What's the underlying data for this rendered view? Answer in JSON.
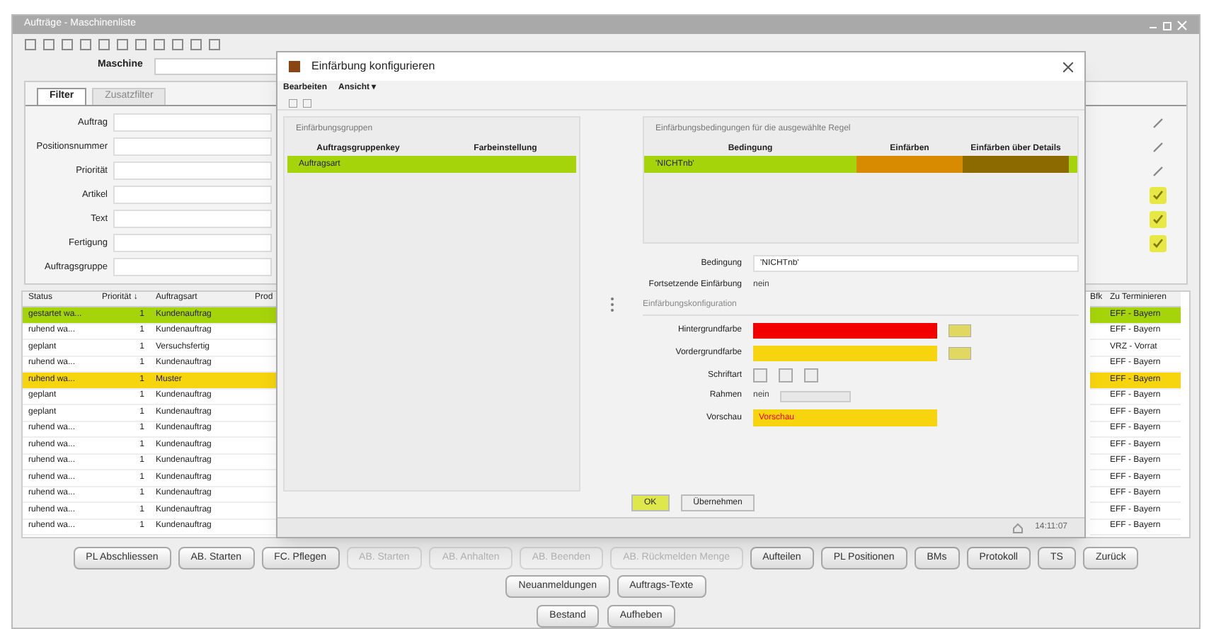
{
  "window": {
    "title": "Aufträge - Maschinenliste"
  },
  "machine_field": {
    "label": "Maschine"
  },
  "tabs": [
    {
      "label": "Filter",
      "selected": true
    },
    {
      "label": "Zusatzfilter",
      "selected": false
    }
  ],
  "filters": [
    {
      "label": "Auftrag",
      "kind": "edit"
    },
    {
      "label": "Positionsnummer",
      "kind": "edit"
    },
    {
      "label": "Priorität",
      "kind": "edit"
    },
    {
      "label": "Artikel",
      "kind": "check"
    },
    {
      "label": "Text",
      "kind": "check"
    },
    {
      "label": "Fertigung",
      "kind": "check"
    },
    {
      "label": "Auftragsgruppe",
      "kind": "none"
    }
  ],
  "table": {
    "columns_left": [
      "Status",
      "Priorität ↓",
      "Auftragsart",
      "Prod"
    ],
    "columns_right": [
      "Bfk",
      "Zu Terminieren"
    ],
    "rows": [
      {
        "status": "gestartet wa...",
        "priority": "1",
        "type": "Kundenauftrag",
        "right": "EFF - Bayern",
        "color": "#a6d40a"
      },
      {
        "status": "ruhend wa...",
        "priority": "1",
        "type": "Kundenauftrag",
        "right": "EFF - Bayern"
      },
      {
        "status": "geplant",
        "priority": "1",
        "type": "Versuchsfertig",
        "right": "VRZ - Vorrat"
      },
      {
        "status": "ruhend wa...",
        "priority": "1",
        "type": "Kundenauftrag",
        "right": "EFF - Bayern"
      },
      {
        "status": "ruhend wa...",
        "priority": "1",
        "type": "Muster",
        "right": "EFF - Bayern",
        "color": "#f6d40e"
      },
      {
        "status": "geplant",
        "priority": "1",
        "type": "Kundenauftrag",
        "right": "EFF - Bayern"
      },
      {
        "status": "geplant",
        "priority": "1",
        "type": "Kundenauftrag",
        "right": "EFF - Bayern"
      },
      {
        "status": "ruhend wa...",
        "priority": "1",
        "type": "Kundenauftrag",
        "right": "EFF - Bayern"
      },
      {
        "status": "ruhend wa...",
        "priority": "1",
        "type": "Kundenauftrag",
        "right": "EFF - Bayern"
      },
      {
        "status": "ruhend wa...",
        "priority": "1",
        "type": "Kundenauftrag",
        "right": "EFF - Bayern"
      },
      {
        "status": "ruhend wa...",
        "priority": "1",
        "type": "Kundenauftrag",
        "right": "EFF - Bayern"
      },
      {
        "status": "ruhend wa...",
        "priority": "1",
        "type": "Kundenauftrag",
        "right": "EFF - Bayern"
      },
      {
        "status": "ruhend wa...",
        "priority": "1",
        "type": "Kundenauftrag",
        "right": "EFF - Bayern"
      },
      {
        "status": "ruhend wa...",
        "priority": "1",
        "type": "Kundenauftrag",
        "right": "EFF - Bayern"
      }
    ]
  },
  "buttons": [
    {
      "label": "PL Abschliessen",
      "disabled": false
    },
    {
      "label": "AB. Starten",
      "disabled": false
    },
    {
      "label": "FC. Pflegen",
      "disabled": false
    },
    {
      "label": "AB. Starten",
      "disabled": true
    },
    {
      "label": "AB. Anhalten",
      "disabled": true
    },
    {
      "label": "AB. Beenden",
      "disabled": true
    },
    {
      "label": "AB. Rückmelden Menge",
      "disabled": true
    },
    {
      "label": "Aufteilen",
      "disabled": false
    },
    {
      "label": "PL Positionen",
      "disabled": false
    },
    {
      "label": "BMs",
      "disabled": false
    },
    {
      "label": "Protokoll",
      "disabled": false
    },
    {
      "label": "TS",
      "disabled": false
    },
    {
      "label": "Zurück",
      "disabled": false
    },
    {
      "label": "Neuanmeldungen",
      "disabled": false
    },
    {
      "label": "Auftrags-Texte",
      "disabled": false
    }
  ],
  "buttons_row2": [
    "Bestand",
    "Aufheben"
  ],
  "dialog": {
    "title": "Einfärbung konfigurieren",
    "menu": [
      "Bearbeiten",
      "Ansicht ▾"
    ],
    "groups_panel": {
      "title": "Einfärbungsgruppen",
      "columns": [
        "Auftragsgruppenkey",
        "Farbeinstellung"
      ],
      "rows": [
        {
          "label": "Auftragsart",
          "selected": true
        }
      ]
    },
    "rules_panel": {
      "title": "Einfärbungsbedingungen für die ausgewählte Regel",
      "columns": [
        "Bedingung",
        "Einfärben",
        "Einfärben über Details"
      ],
      "rows": [
        {
          "condition": "'NICHTnb'",
          "selected": true,
          "cells": [
            {
              "color": "#d98b00"
            },
            {
              "color": "#8c6a00"
            }
          ]
        }
      ]
    },
    "condition": {
      "label": "Bedingung",
      "value": "'NICHTnb'"
    },
    "continue": {
      "label": "Fortsetzende Einfärbung",
      "value": "nein"
    },
    "section": "Einfärbungskonfiguration",
    "background": {
      "label": "Hintergrundfarbe",
      "color": "#f20000"
    },
    "foreground": {
      "label": "Vordergrundfarbe",
      "color": "#f6d40e"
    },
    "font_label": "Schriftart",
    "border": {
      "label": "Rahmen",
      "value": "nein"
    },
    "preview": {
      "label": "Vorschau",
      "text": "Vorschau"
    },
    "ok": "OK",
    "apply": "Übernehmen",
    "time": "14:11:07"
  }
}
